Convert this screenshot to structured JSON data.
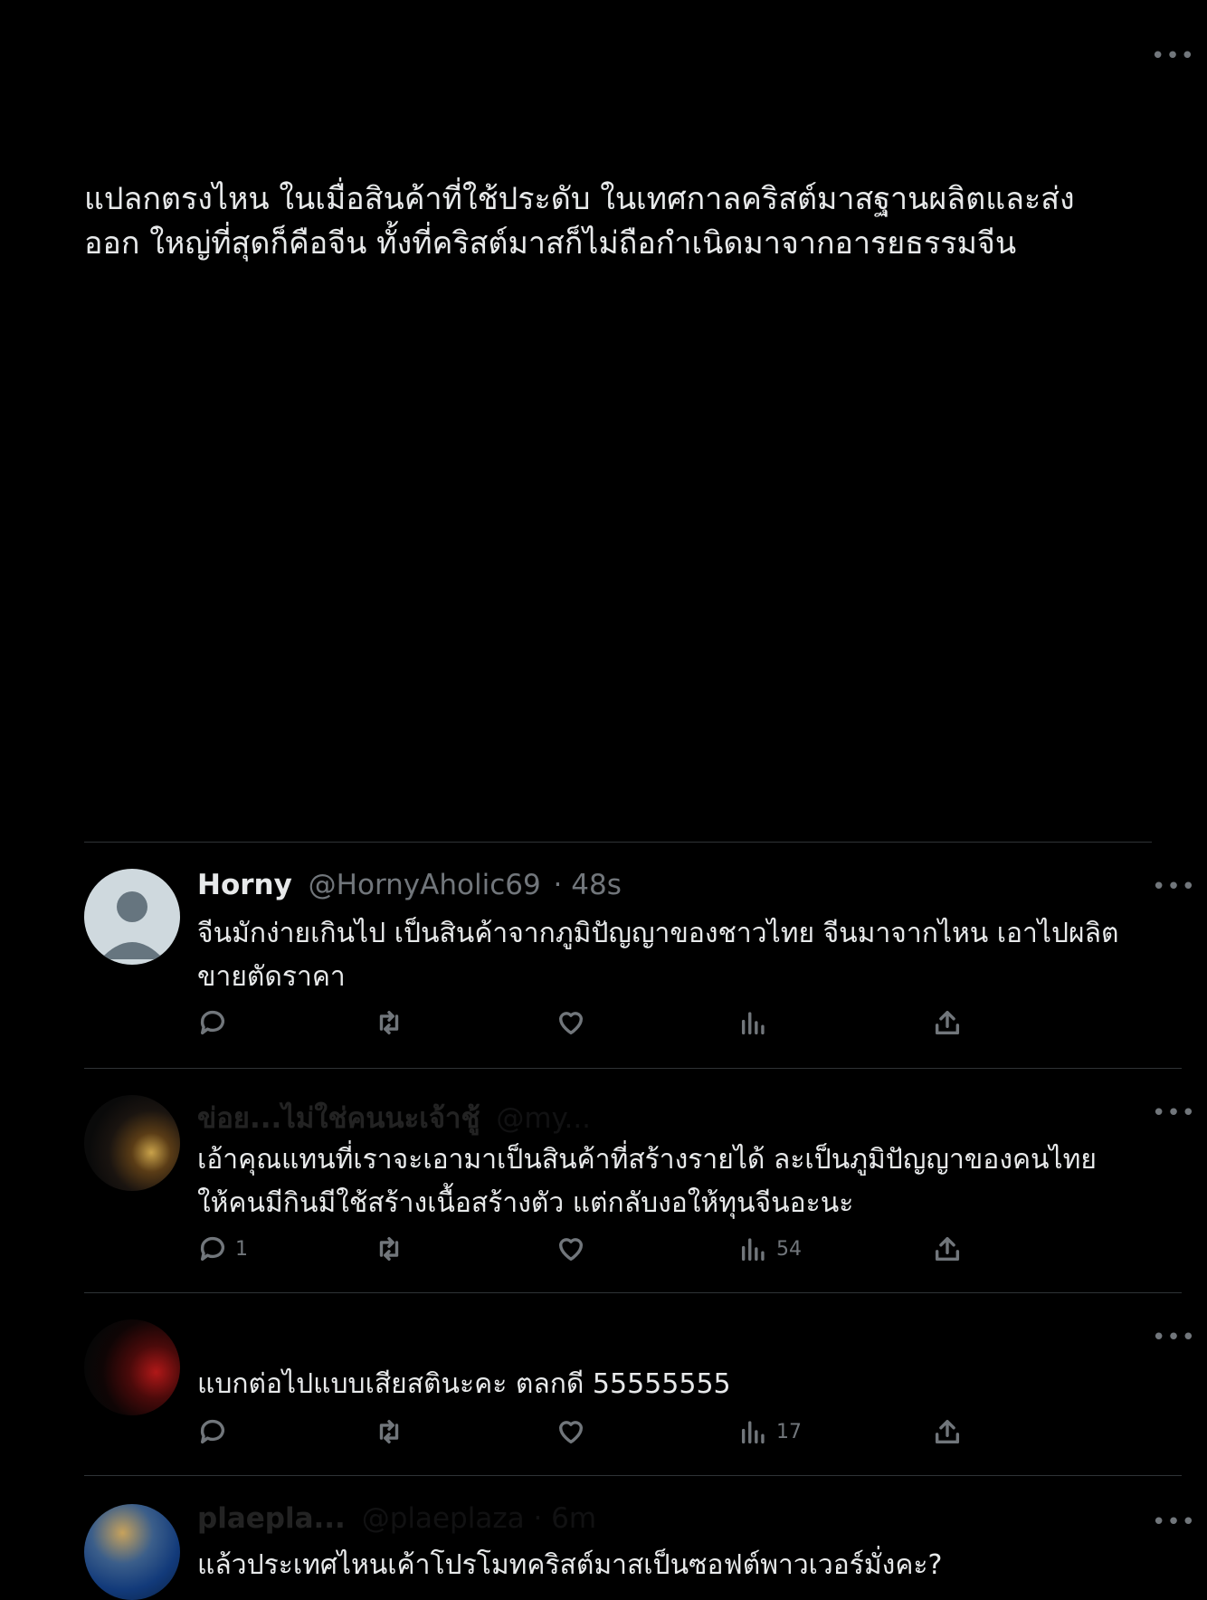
{
  "post": {
    "more_label": "•••",
    "text_line1": "แปลกตรงไหน ในเมื่อสินค้าที่ใช้ประดับ ในเทศกาลคริสต์มาสฐานผลิตและส่ง",
    "text_line2": "ออก ใหญ่ที่สุดก็คือจีน ทั้งที่คริสต์มาสก็ไม่ถือกำเนิดมาจากอารยธรรมจีน"
  },
  "replies": [
    {
      "name": "Horny",
      "handle": "@HornyAholic69",
      "time": "· 48s",
      "line1": "จีนมักง่ายเกินไป เป็นสินค้าจากภูมิปัญญาของชาวไทย จีนมาจากไหน เอาไปผลิต",
      "line2": "ขายตัดราคา",
      "reply_count": "",
      "views": "",
      "more_label": "•••",
      "avatar_icon": "default-avatar-icon"
    },
    {
      "name": "ข่อย...ไม่ใช่คนนะเจ้าชู้",
      "handle": "@my...",
      "time": "",
      "line1": "เอ้าคุณแทนที่เราจะเอามาเป็นสินค้าที่สร้างรายได้ ละเป็นภูมิปัญญาของคนไทย",
      "line2": "ให้คนมีกินมีใช้สร้างเนื้อสร้างตัว แต่กลับงอให้ทุนจีนอะนะ",
      "reply_count": "1",
      "views": "54",
      "more_label": "•••"
    },
    {
      "name": "",
      "handle": "",
      "time": "",
      "line1": "แบกต่อไปแบบเสียสตินะคะ ตลกดี 55555555",
      "line2": "",
      "reply_count": "",
      "views": "17",
      "more_label": "•••"
    },
    {
      "name": "plaepla...",
      "handle": "@plaeplaza · 6m",
      "time": "",
      "line1": "แล้วประเทศไหนเค้าโปรโมทคริสต์มาสเป็นซอฟต์พาวเวอร์มั่งคะ?",
      "line2": "",
      "more_label": "•••"
    }
  ],
  "colors": {
    "background": "#000000",
    "text": "#e7e9ea",
    "muted": "#71767b",
    "divider": "#2f3336"
  }
}
